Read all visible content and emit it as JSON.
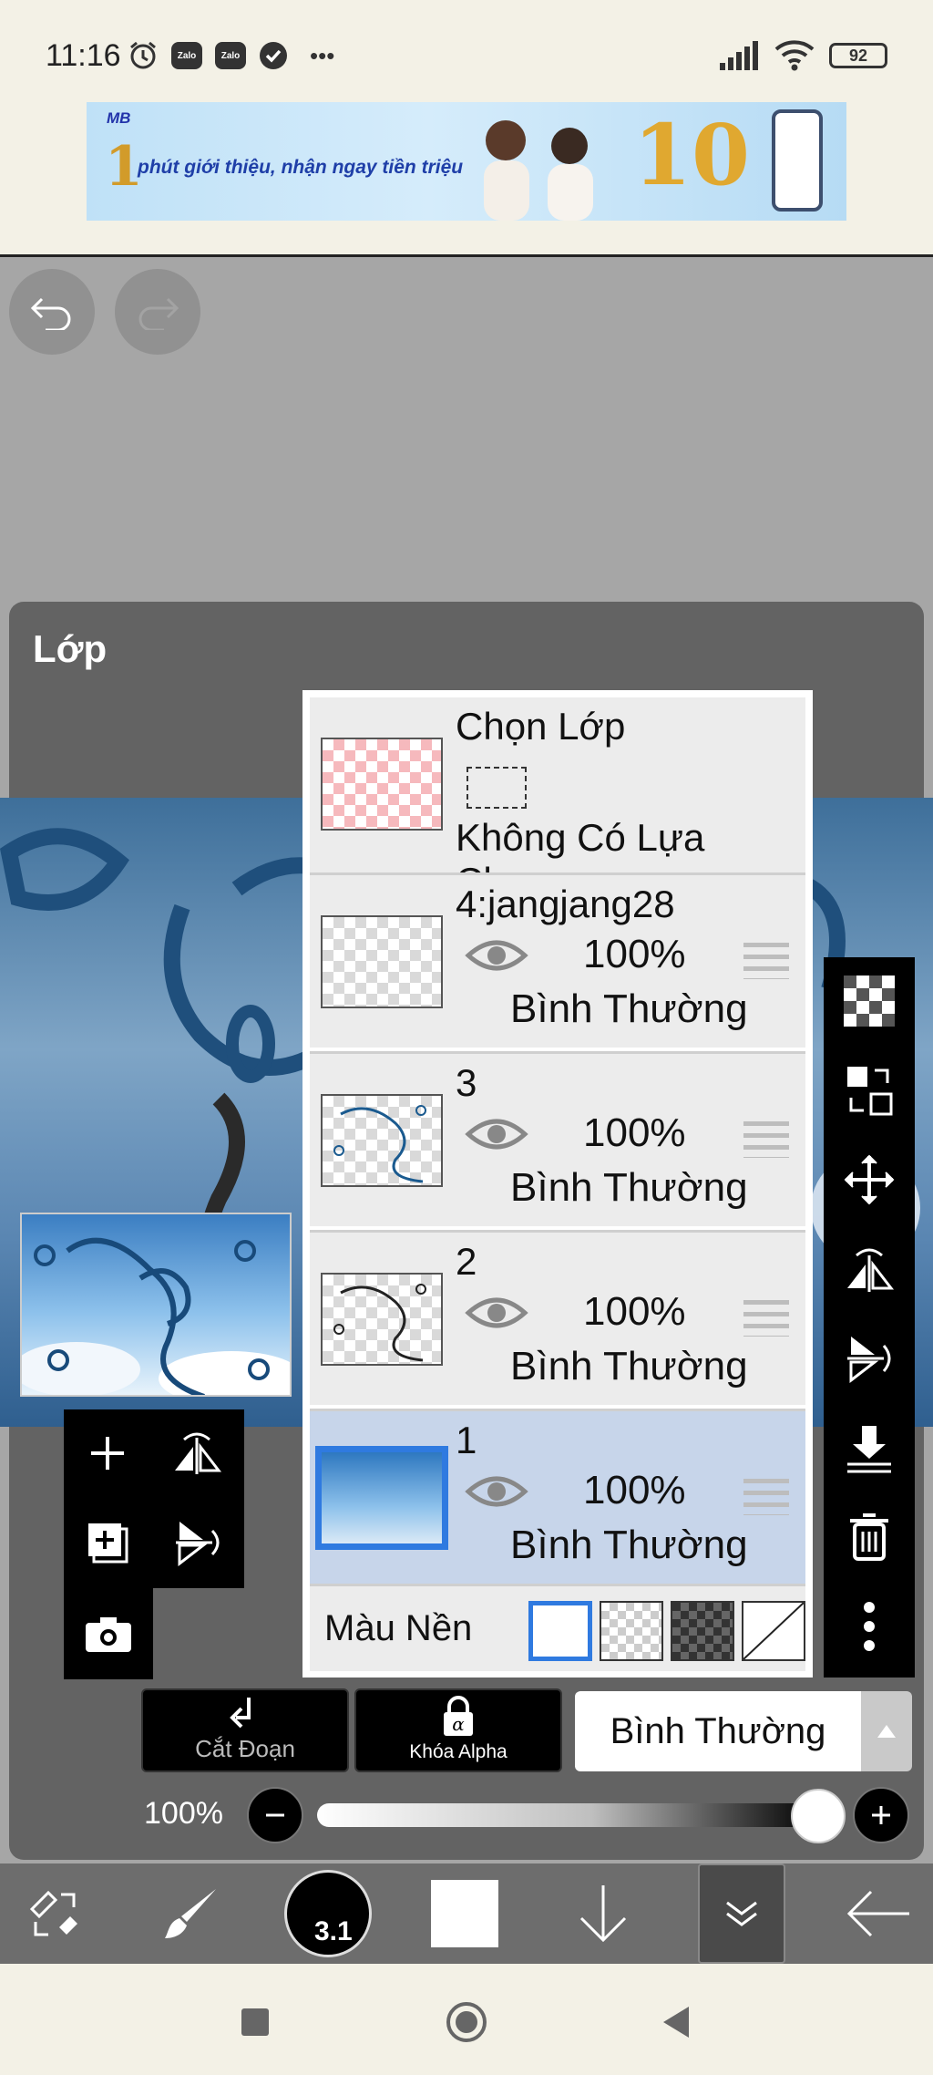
{
  "status_bar": {
    "time": "11:16",
    "zalo_1": "Zalo",
    "zalo_2": "Zalo",
    "more": "•••",
    "battery": "92"
  },
  "ad": {
    "brand": "MB",
    "big_number": "1",
    "tagline": "phút giới thiệu, nhận ngay tiền triệu",
    "prize": "10"
  },
  "panel": {
    "title": "Lớp"
  },
  "selection_row": {
    "title": "Chọn Lớp",
    "status": "Không Có Lựa Chọn"
  },
  "layers": [
    {
      "name": "4:jangjang28",
      "opacity": "100%",
      "blend": "Bình Thường"
    },
    {
      "name": "3",
      "opacity": "100%",
      "blend": "Bình Thường"
    },
    {
      "name": "2",
      "opacity": "100%",
      "blend": "Bình Thường"
    },
    {
      "name": "1",
      "opacity": "100%",
      "blend": "Bình Thường"
    }
  ],
  "background_row": {
    "label": "Màu Nền"
  },
  "clip_button": {
    "label": "Cắt Đoạn"
  },
  "alpha_button": {
    "label": "Khóa Alpha"
  },
  "blend_mode": {
    "value": "Bình Thường"
  },
  "opacity_slider": {
    "value_label": "100%",
    "value": 1.0
  },
  "bottom_bar": {
    "brush_size": "3.1"
  },
  "colors": {
    "panel_bg": "#636363",
    "active_layer": "#c7d5ea",
    "accent_blue": "#2f7ae0",
    "toolbar_bg": "#000000"
  }
}
